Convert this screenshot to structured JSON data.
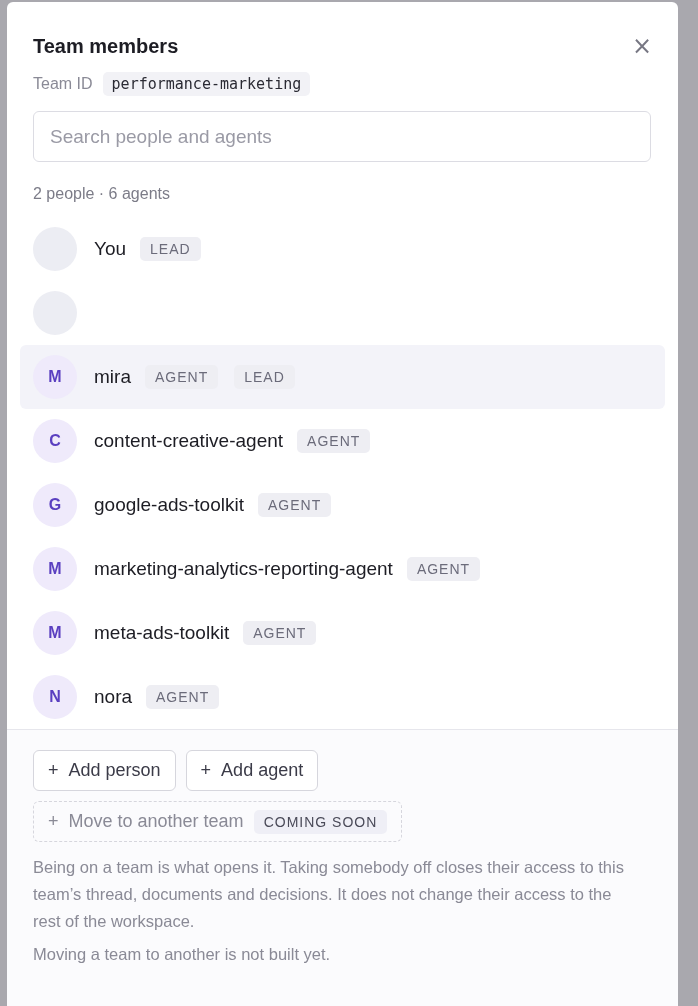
{
  "dialog": {
    "title": "Team members",
    "close": "×",
    "team_id_label": "Team ID",
    "team_id": "performance-marketing",
    "search": {
      "placeholder": "Search people and agents"
    },
    "summary": "2 people · 6 agents",
    "members": [
      {
        "kind": "person",
        "name": "You",
        "badges": [
          "LEAD"
        ],
        "selected": false
      },
      {
        "kind": "person",
        "selected": false
      },
      {
        "kind": "agent",
        "name": "mira",
        "initial": "M",
        "badges": [
          "AGENT",
          "LEAD"
        ],
        "selected": true
      },
      {
        "kind": "agent",
        "name": "content-creative-agent",
        "initial": "C",
        "badges": [
          "AGENT"
        ],
        "selected": false
      },
      {
        "kind": "agent",
        "name": "google-ads-toolkit",
        "initial": "G",
        "badges": [
          "AGENT"
        ],
        "selected": false
      },
      {
        "kind": "agent",
        "name": "marketing-analytics-reporting-agent",
        "initial": "M",
        "badges": [
          "AGENT"
        ],
        "selected": false
      },
      {
        "kind": "agent",
        "name": "meta-ads-toolkit",
        "initial": "M",
        "badges": [
          "AGENT"
        ],
        "selected": false
      },
      {
        "kind": "agent",
        "name": "nora",
        "initial": "N",
        "badges": [
          "AGENT"
        ],
        "selected": false
      }
    ],
    "actions": [
      {
        "icon": "+",
        "label": "Add person",
        "disabled": false
      },
      {
        "icon": "+",
        "label": "Add agent",
        "disabled": false
      }
    ],
    "move": {
      "icon": "+",
      "label": "Move to another team",
      "badge": "COMING SOON",
      "disabled": true
    },
    "notes": [
      "Being on a team is what opens it. Taking somebody off closes their access to this team’s thread, documents and decisions. It does not change their access to the rest of the workspace.",
      "Moving a team to another is not built yet."
    ]
  }
}
